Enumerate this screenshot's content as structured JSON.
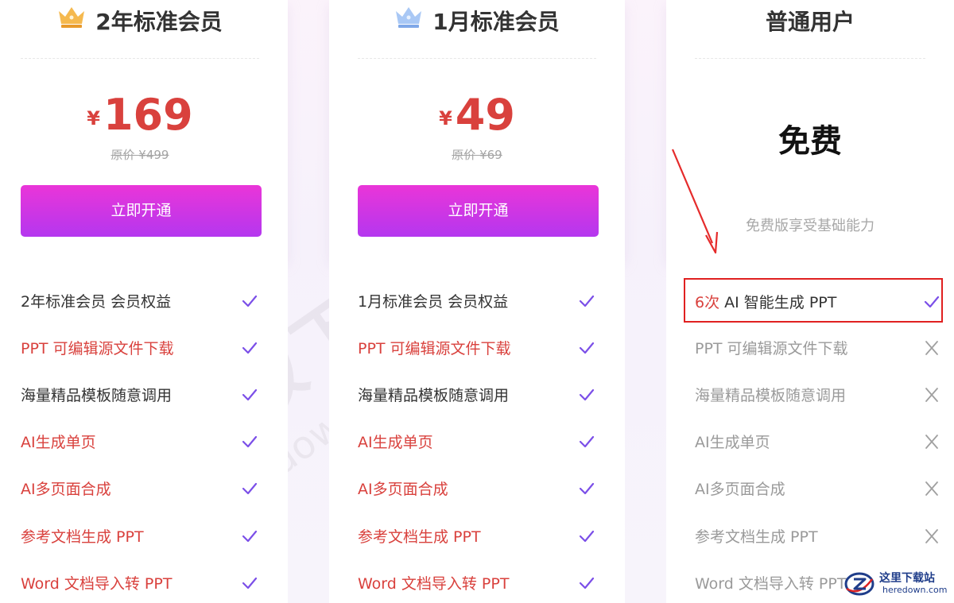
{
  "colors": {
    "price_red": "#d9413d",
    "button_gradient_top": "#ea35d8",
    "button_gradient_bottom": "#b437ef",
    "check_purple": "#7b4fe8",
    "highlight_red": "#e02020"
  },
  "plans": [
    {
      "icon": "gold-crown-icon",
      "title": "2年标准会员",
      "currency": "¥",
      "price": "169",
      "original_price": "原价 ¥499",
      "button_label": "立即开通",
      "features": [
        {
          "text": "2年标准会员 会员权益",
          "color": "dark",
          "included": true
        },
        {
          "text": "PPT 可编辑源文件下载",
          "color": "red",
          "included": true
        },
        {
          "text": "海量精品模板随意调用",
          "color": "dark",
          "included": true
        },
        {
          "text": "AI生成单页",
          "color": "red",
          "included": true
        },
        {
          "text": "AI多页面合成",
          "color": "red",
          "included": true
        },
        {
          "text": "参考文档生成 PPT",
          "color": "red",
          "included": true
        },
        {
          "text": "Word 文档导入转 PPT",
          "color": "red",
          "included": true
        }
      ]
    },
    {
      "icon": "blue-crown-icon",
      "title": "1月标准会员",
      "currency": "¥",
      "price": "49",
      "original_price": "原价 ¥69",
      "button_label": "立即开通",
      "features": [
        {
          "text": "1月标准会员 会员权益",
          "color": "dark",
          "included": true
        },
        {
          "text": "PPT 可编辑源文件下载",
          "color": "red",
          "included": true
        },
        {
          "text": "海量精品模板随意调用",
          "color": "dark",
          "included": true
        },
        {
          "text": "AI生成单页",
          "color": "red",
          "included": true
        },
        {
          "text": "AI多页面合成",
          "color": "red",
          "included": true
        },
        {
          "text": "参考文档生成 PPT",
          "color": "red",
          "included": true
        },
        {
          "text": "Word 文档导入转 PPT",
          "color": "red",
          "included": true
        }
      ]
    },
    {
      "title": "普通用户",
      "price_text": "免费",
      "description": "免费版享受基础能力",
      "features": [
        {
          "count": "6次",
          "text": "AI 智能生成 PPT",
          "included": true,
          "highlighted": true
        },
        {
          "text": "PPT 可编辑源文件下载",
          "included": false
        },
        {
          "text": "海量精品模板随意调用",
          "included": false
        },
        {
          "text": "AI生成单页",
          "included": false
        },
        {
          "text": "AI多页面合成",
          "included": false
        },
        {
          "text": "参考文档生成 PPT",
          "included": false
        },
        {
          "text": "Word 文档导入转 PPT",
          "included": false
        }
      ]
    }
  ],
  "watermark": {
    "main": "天极下载站",
    "sub": "mydown.yesky.com"
  },
  "site_logo": {
    "name": "这里下载站",
    "domain": "heredown.com"
  }
}
